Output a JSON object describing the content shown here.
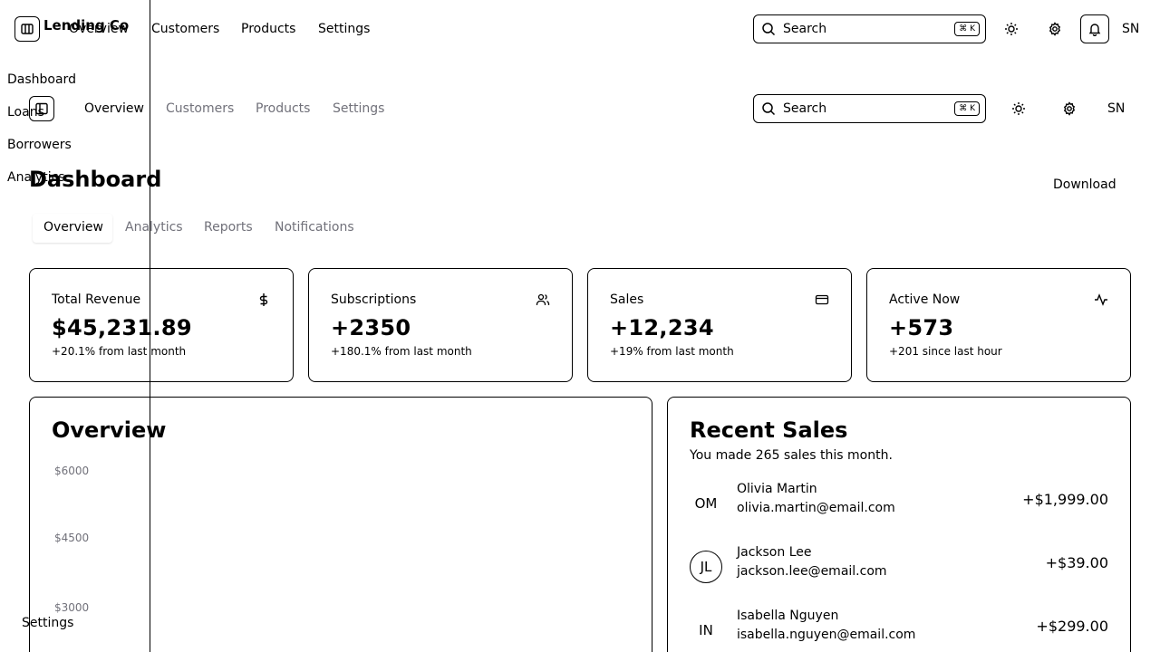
{
  "sidebar": {
    "brand": "Lending Co",
    "items": [
      "Dashboard",
      "Loans",
      "Borrowers",
      "Analytics"
    ],
    "footer": "Settings"
  },
  "top_nav": {
    "links": [
      "Overview",
      "Customers",
      "Products",
      "Settings"
    ],
    "search": {
      "label": "Search",
      "shortcut": "⌘ K"
    },
    "user_initials": "SN"
  },
  "sub_nav": {
    "links": [
      "Overview",
      "Customers",
      "Products",
      "Settings"
    ],
    "search": {
      "label": "Search",
      "shortcut": "⌘ K"
    },
    "user_initials": "SN"
  },
  "page": {
    "title": "Dashboard",
    "download_label": "Download",
    "tabs": [
      "Overview",
      "Analytics",
      "Reports",
      "Notifications"
    ]
  },
  "stats": [
    {
      "title": "Total Revenue",
      "value": "$45,231.89",
      "sub": "+20.1% from last month",
      "icon": "dollar-icon"
    },
    {
      "title": "Subscriptions",
      "value": "+2350",
      "sub": "+180.1% from last month",
      "icon": "users-icon"
    },
    {
      "title": "Sales",
      "value": "+12,234",
      "sub": "+19% from last month",
      "icon": "credit-card-icon"
    },
    {
      "title": "Active Now",
      "value": "+573",
      "sub": "+201 since last hour",
      "icon": "activity-icon"
    }
  ],
  "overview": {
    "title": "Overview",
    "y_ticks": [
      "$6000",
      "$4500",
      "$3000"
    ]
  },
  "recent_sales": {
    "title": "Recent Sales",
    "subtitle": "You made 265 sales this month.",
    "rows": [
      {
        "initials": "OM",
        "name": "Olivia Martin",
        "email": "olivia.martin@email.com",
        "amount": "+$1,999.00"
      },
      {
        "initials": "JL",
        "name": "Jackson Lee",
        "email": "jackson.lee@email.com",
        "amount": "+$39.00"
      },
      {
        "initials": "IN",
        "name": "Isabella Nguyen",
        "email": "isabella.nguyen@email.com",
        "amount": "+$299.00"
      }
    ]
  }
}
